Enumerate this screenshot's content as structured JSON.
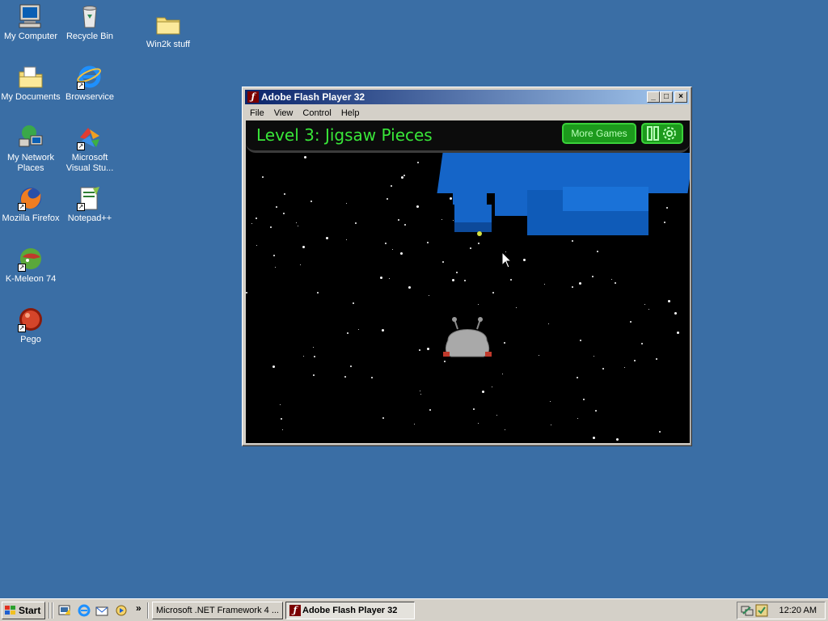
{
  "desktop": {
    "background": "#3a6ea5",
    "icons": [
      {
        "label": "My Computer",
        "icon": "my-computer-icon"
      },
      {
        "label": "Recycle Bin",
        "icon": "recycle-bin-icon"
      },
      {
        "label": "Win2k stuff",
        "icon": "folder-icon"
      },
      {
        "label": "My Documents",
        "icon": "my-documents-icon"
      },
      {
        "label": "Browservice",
        "icon": "internet-explorer-icon"
      },
      {
        "label": "My Network",
        "label2": "Places",
        "icon": "network-places-icon"
      },
      {
        "label": "Microsoft",
        "label2": "Visual Stu...",
        "icon": "visual-studio-icon"
      },
      {
        "label": "Mozilla Firefox",
        "icon": "firefox-icon"
      },
      {
        "label": "Notepad++",
        "icon": "notepad-plus-plus-icon"
      },
      {
        "label": "K-Meleon 74",
        "icon": "k-meleon-icon"
      },
      {
        "label": "Pego",
        "icon": "pego-icon"
      }
    ]
  },
  "window": {
    "title": "Adobe Flash Player 32",
    "menu": [
      "File",
      "View",
      "Control",
      "Help"
    ],
    "caption_buttons": {
      "minimize": "_",
      "maximize": "□",
      "close": "×"
    }
  },
  "game": {
    "level_title": "Level 3: Jigsaw Pieces",
    "more_games_label": "More Games",
    "accent": "#39e639",
    "block_color": "#1565c8"
  },
  "taskbar": {
    "start_label": "Start",
    "quick_launch": [
      "show-desktop-icon",
      "internet-explorer-icon",
      "outlook-express-icon",
      "media-player-icon"
    ],
    "chevron": "»",
    "tasks": [
      {
        "label": "Microsoft .NET Framework 4 ...",
        "active": false
      },
      {
        "label": "Adobe Flash Player 32",
        "active": true
      }
    ],
    "clock": "12:20 AM"
  }
}
